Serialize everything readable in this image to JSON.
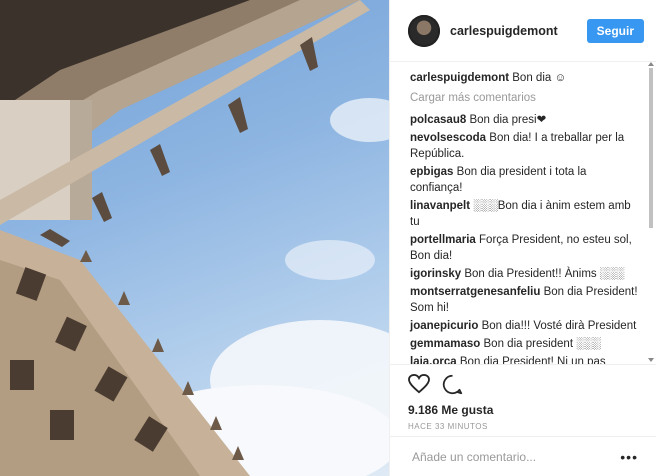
{
  "post": {
    "image_alt": "",
    "username": "carlespuigdemont",
    "follow_label": "Seguir"
  },
  "caption": {
    "user": "carlespuigdemont",
    "text": "Bon dia ☺"
  },
  "load_more": "Cargar más comentarios",
  "comments": [
    {
      "user": "polcasau8",
      "text": "Bon dia presi❤"
    },
    {
      "user": "nevolsescoda",
      "text": "Bon dia! I a treballar per la República."
    },
    {
      "user": "epbigas",
      "text": "Bon dia president i tota la confiança!"
    },
    {
      "user": "linavanpelt",
      "text": "░░░Bon dia i ànim estem amb tu"
    },
    {
      "user": "portellmaria",
      "text": "Força President, no esteu sol, Bon dia!"
    },
    {
      "user": "igorinsky",
      "text": "Bon dia President!! Ànims ░░░"
    },
    {
      "user": "montserratgenesanfeliu",
      "text": "Bon dia President! Som hi!"
    },
    {
      "user": "joanepicurio",
      "text": "Bon dia!!! Vosté dirà President"
    },
    {
      "user": "gemmamaso",
      "text": "Bon dia president ░░░"
    },
    {
      "user": "laia.orca",
      "text": "Bon dia President! Ni un pas"
    }
  ],
  "likes": "9.186 Me gusta",
  "timestamp": "HACE 33 MINUTOS",
  "add_comment_placeholder": "Añade un comentario...",
  "more_options": "•••",
  "colors": {
    "accent": "#3897f0",
    "muted": "#999999"
  }
}
